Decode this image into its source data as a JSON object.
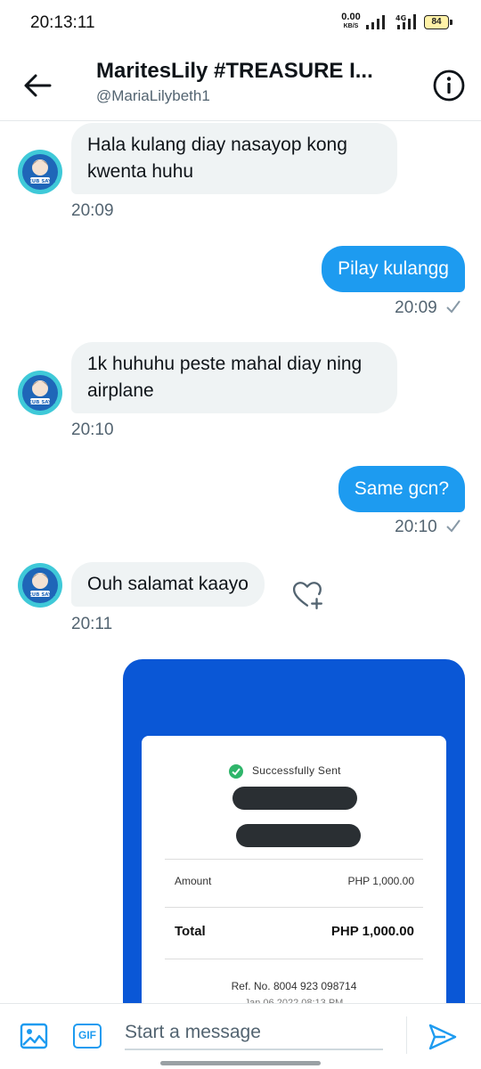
{
  "status_bar": {
    "time": "20:13:11",
    "net_speed": "0.00",
    "net_unit": "KB/S",
    "network_type": "4G",
    "battery": "84"
  },
  "header": {
    "title": "MaritesLily #TREASURE I...",
    "handle": "@MariaLilybeth1"
  },
  "messages": [
    {
      "direction": "in",
      "text": "Hala kulang diay nasayop kong kwenta huhu",
      "time": "20:09"
    },
    {
      "direction": "out",
      "text": "Pilay kulangg",
      "time": "20:09"
    },
    {
      "direction": "in",
      "text": "1k huhuhu peste mahal diay ning airplane",
      "time": "20:10"
    },
    {
      "direction": "out",
      "text": "Same gcn?",
      "time": "20:10"
    },
    {
      "direction": "in",
      "text": "Ouh salamat  kaayo",
      "time": "20:11"
    }
  ],
  "avatar_text": "TEUB SAYA",
  "receipt": {
    "status": "Successfully Sent",
    "amount_label": "Amount",
    "amount_value": "PHP 1,000.00",
    "total_label": "Total",
    "total_value": "PHP 1,000.00",
    "ref": "Ref. No. 8004 923 098714",
    "date_partial": "Jan 06 2022 08:13 PM"
  },
  "composer": {
    "gif_label": "GIF",
    "placeholder": "Start a message"
  },
  "colors": {
    "accent": "#1d9bf0",
    "receipt_blue": "#0a57d6",
    "bubble_in": "#eff3f4",
    "success_green": "#2fb56a"
  },
  "icons": [
    "back-arrow-icon",
    "info-icon",
    "checkmark-icon",
    "heart-plus-icon",
    "image-icon",
    "gif-icon",
    "send-icon"
  ]
}
